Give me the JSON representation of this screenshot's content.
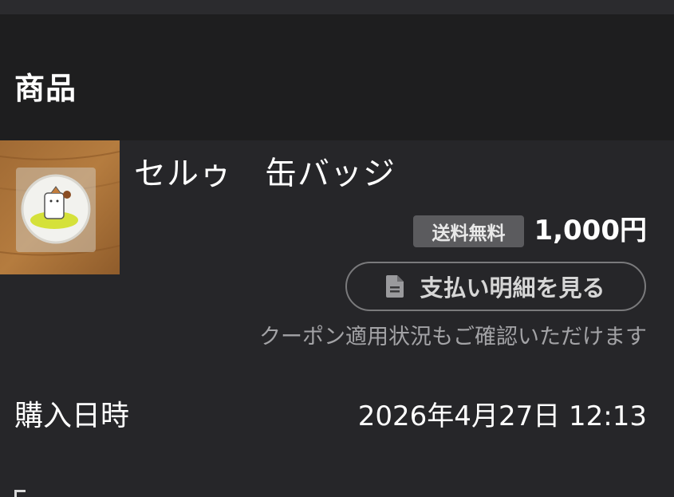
{
  "section": {
    "title": "商品"
  },
  "product": {
    "name": "セルゥ　缶バッジ",
    "image_icon": "can-badge-photo",
    "shipping_badge": "送料無料",
    "price": "1,000円"
  },
  "receipt_button": {
    "label": "支払い明細を見る",
    "icon": "document-icon"
  },
  "coupon_note": "クーポン適用状況もご確認いただけます",
  "purchase": {
    "label": "購入日時",
    "value": "2026年4月27日 12:13"
  },
  "colors": {
    "background": "#262629",
    "header_background": "#1e1e1f",
    "badge_background": "#5b5b5e",
    "muted_text": "#a3a3a6"
  }
}
